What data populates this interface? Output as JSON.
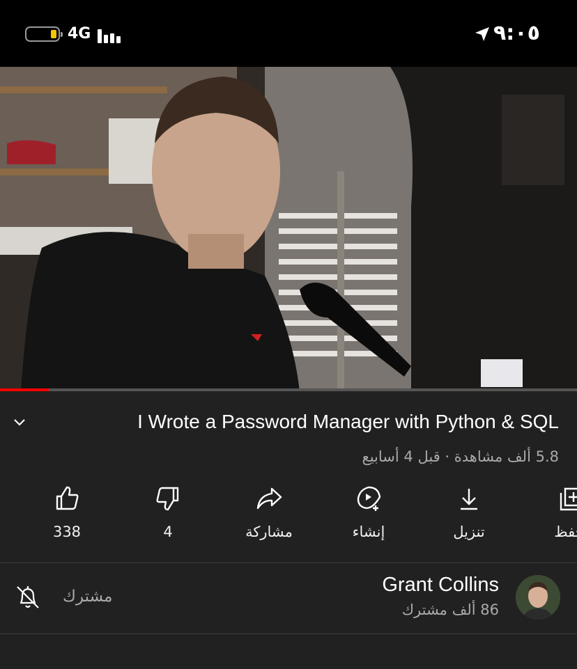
{
  "status_bar": {
    "network": "4G",
    "time": "٩:٠٥",
    "battery_level": 0.2,
    "battery_color": "#f5c400"
  },
  "video": {
    "progress": 0.085,
    "progress_color": "#ff0000",
    "title": "I Wrote a Password Manager with Python & SQL",
    "meta": "5.8 ألف مشاهدة · قبل 4 أسابيع"
  },
  "actions": [
    {
      "icon": "thumbs-up-icon",
      "label": "338"
    },
    {
      "icon": "thumbs-down-icon",
      "label": "4"
    },
    {
      "icon": "share-icon",
      "label": "مشاركة"
    },
    {
      "icon": "create-icon",
      "label": "إنشاء"
    },
    {
      "icon": "download-icon",
      "label": "تنزيل"
    },
    {
      "icon": "save-icon",
      "label": "حفظ"
    }
  ],
  "channel": {
    "name": "Grant Collins",
    "subscribers": "86 ألف مشترك",
    "subscribe_state": "مشترك",
    "notification_icon": "bell-off-icon"
  }
}
